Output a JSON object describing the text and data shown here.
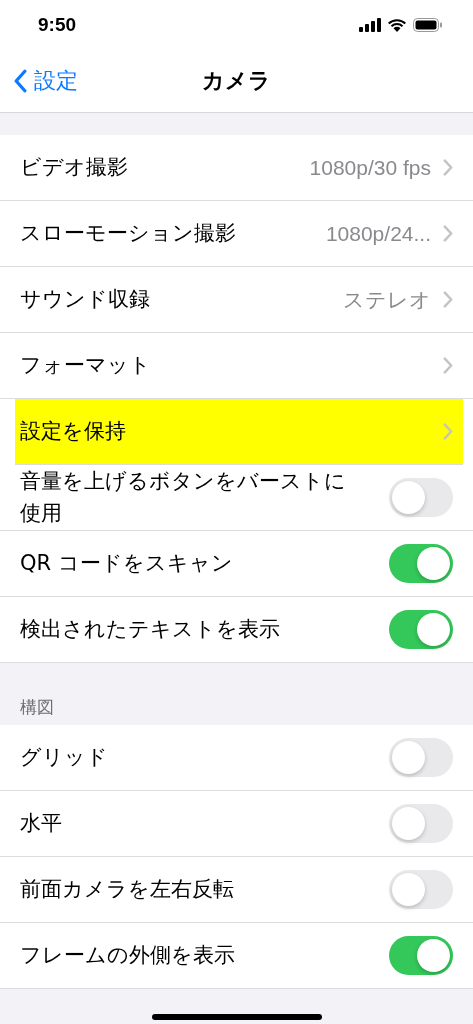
{
  "status_bar": {
    "time": "9:50"
  },
  "nav": {
    "back": "設定",
    "title": "カメラ"
  },
  "sections": [
    {
      "rows": [
        {
          "kind": "link",
          "label": "ビデオ撮影",
          "value": "1080p/30 fps",
          "highlighted": false
        },
        {
          "kind": "link",
          "label": "スローモーション撮影",
          "value": "1080p/24...",
          "highlighted": false
        },
        {
          "kind": "link",
          "label": "サウンド収録",
          "value": "ステレオ",
          "highlighted": false
        },
        {
          "kind": "link",
          "label": "フォーマット",
          "highlighted": false
        },
        {
          "kind": "link",
          "label": "設定を保持",
          "highlighted": true
        },
        {
          "kind": "toggle",
          "label": "音量を上げるボタンをバーストに使用",
          "on": false
        },
        {
          "kind": "toggle",
          "label": "QR コードをスキャン",
          "on": true
        },
        {
          "kind": "toggle",
          "label": "検出されたテキストを表示",
          "on": true
        }
      ]
    },
    {
      "header": "構図",
      "rows": [
        {
          "kind": "toggle",
          "label": "グリッド",
          "on": false
        },
        {
          "kind": "toggle",
          "label": "水平",
          "on": false
        },
        {
          "kind": "toggle",
          "label": "前面カメラを左右反転",
          "on": false
        },
        {
          "kind": "toggle",
          "label": "フレームの外側を表示",
          "on": true
        }
      ]
    }
  ]
}
